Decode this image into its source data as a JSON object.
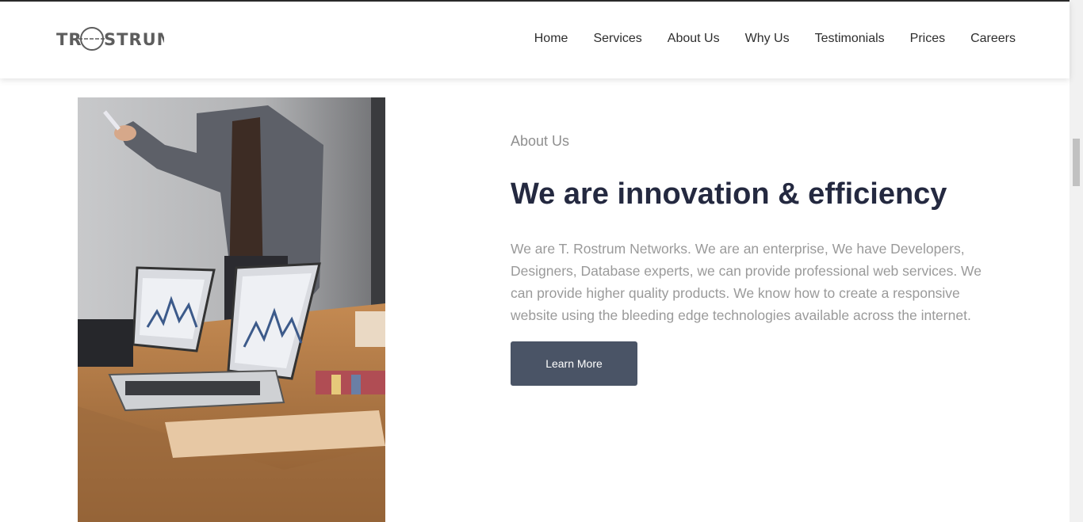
{
  "brand": {
    "logo_text": "TR——STRUM"
  },
  "nav": {
    "items": [
      {
        "label": "Home"
      },
      {
        "label": "Services"
      },
      {
        "label": "About Us"
      },
      {
        "label": "Why Us"
      },
      {
        "label": "Testimonials"
      },
      {
        "label": "Prices"
      },
      {
        "label": "Careers"
      }
    ]
  },
  "about": {
    "eyebrow": "About Us",
    "title": "We are innovation & efficiency",
    "body": "We are T. Rostrum Networks. We are an enterprise, We have Developers, Designers, Database experts, we can provide professional web services. We can provide higher quality products. We know how to create a responsive website using the bleeding edge technologies available across the internet.",
    "cta_label": "Learn More"
  },
  "colors": {
    "title": "#242940",
    "button": "#4a5466",
    "muted_text": "#9a9a9a"
  }
}
